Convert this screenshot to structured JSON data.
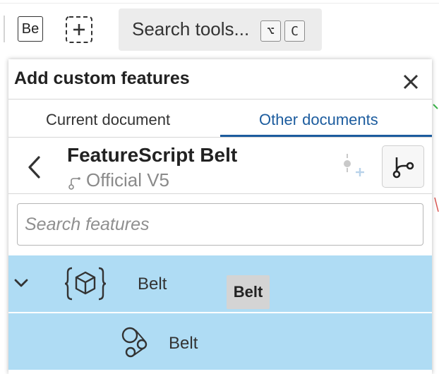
{
  "toolbar": {
    "be_label": "Be",
    "search_tools_label": "Search tools...",
    "shortcut_keys": [
      "⌥",
      "C"
    ]
  },
  "panel": {
    "title": "Add custom features",
    "tabs": [
      {
        "label": "Current document",
        "active": false
      },
      {
        "label": "Other documents",
        "active": true
      }
    ],
    "document": {
      "name": "FeatureScript Belt",
      "version": "Official V5"
    },
    "search": {
      "placeholder": "Search features",
      "value": ""
    },
    "features": [
      {
        "label": "Belt",
        "icon": "featurestudio-cube-icon",
        "expanded": true,
        "tooltip": "Belt"
      },
      {
        "label": "Belt",
        "icon": "belt-pulley-icon"
      }
    ]
  },
  "colors": {
    "accent": "#1c5c9e",
    "selected_row": "#afdcf4",
    "tooltip_bg": "#d4d4d4",
    "search_tools_bg": "#ececec"
  }
}
